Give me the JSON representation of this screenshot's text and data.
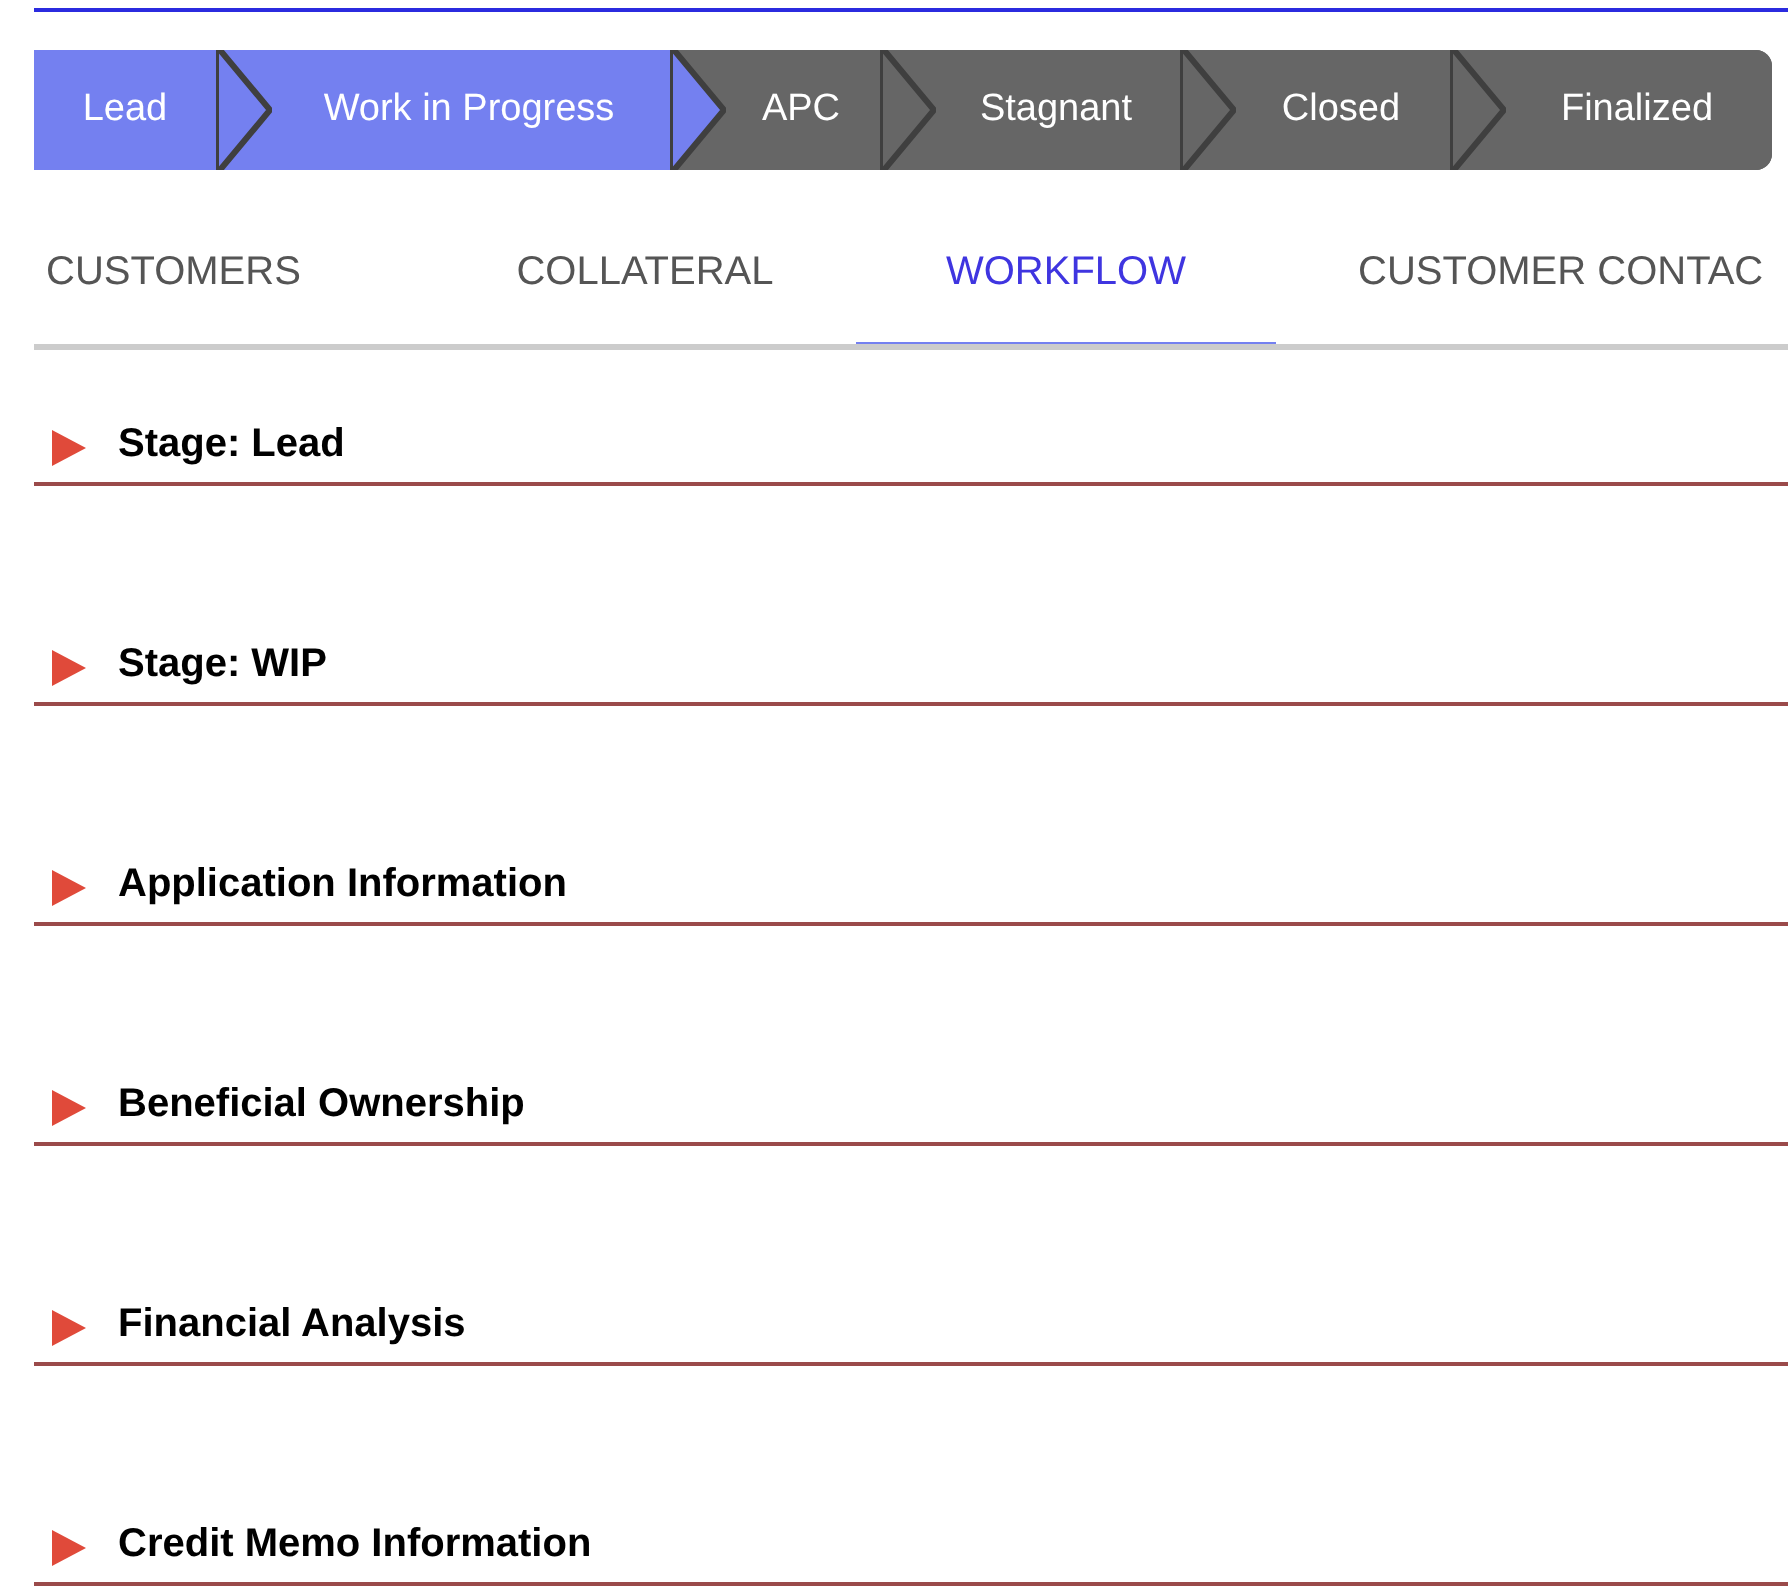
{
  "stages": [
    {
      "label": "Lead",
      "reached": true
    },
    {
      "label": "Work in Progress",
      "reached": true
    },
    {
      "label": "APC",
      "reached": false
    },
    {
      "label": "Stagnant",
      "reached": false
    },
    {
      "label": "Closed",
      "reached": false
    },
    {
      "label": "Finalized",
      "reached": false
    }
  ],
  "tabs": [
    {
      "label": "CUSTOMERS",
      "selected": false
    },
    {
      "label": "COLLATERAL",
      "selected": false
    },
    {
      "label": "WORKFLOW",
      "selected": true
    },
    {
      "label": "CUSTOMER CONTAC",
      "selected": false
    }
  ],
  "sections": [
    {
      "title": "Stage: Lead",
      "expanded": false
    },
    {
      "title": "Stage: WIP",
      "expanded": false
    },
    {
      "title": "Application Information",
      "expanded": false
    },
    {
      "title": "Beneficial Ownership",
      "expanded": false
    },
    {
      "title": "Financial Analysis",
      "expanded": false
    },
    {
      "title": "Credit Memo Information",
      "expanded": false
    }
  ]
}
